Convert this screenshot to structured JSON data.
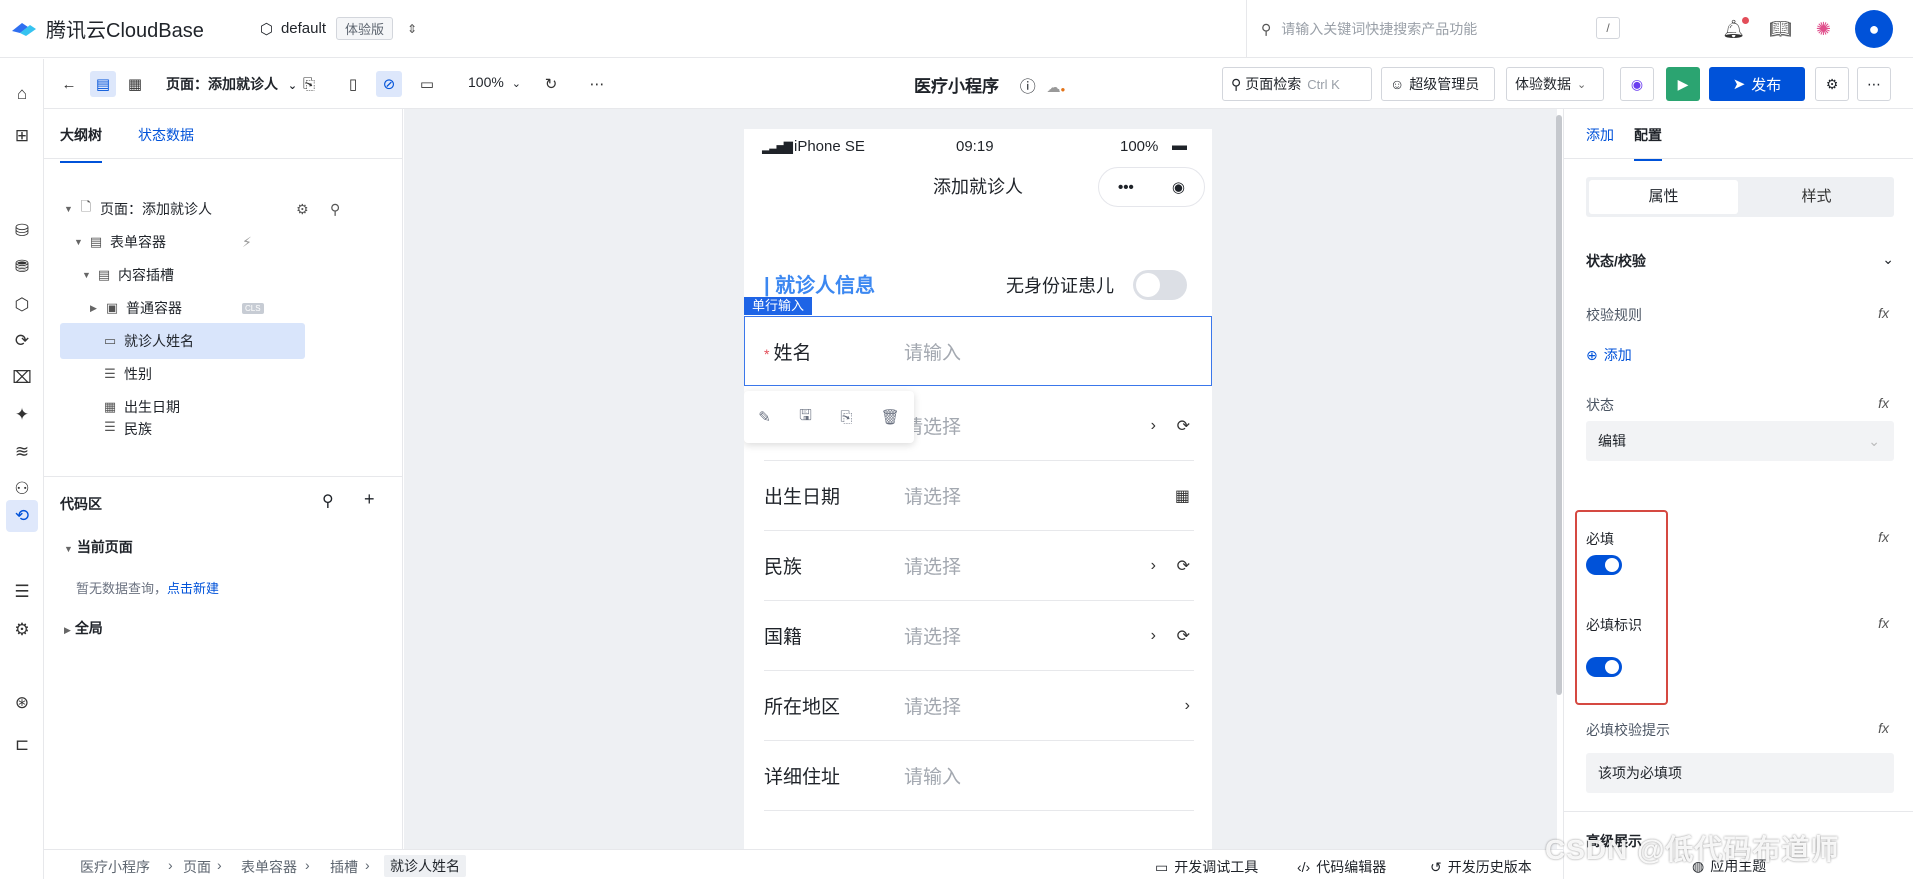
{
  "topbar": {
    "brand": "腾讯云CloudBase",
    "env_name": "default",
    "env_badge": "体验版",
    "search_placeholder": "请输入关键词快捷搜索产品功能",
    "search_shortcut": "/"
  },
  "toolbar": {
    "page_label": "页面：添加就诊人",
    "zoom": "100%",
    "app_title": "医疗小程序",
    "page_search": "页面检索",
    "page_search_shortcut": "Ctrl K",
    "role": "超级管理员",
    "data_mode": "体验数据",
    "publish": "发布"
  },
  "left_panel": {
    "tab_outline": "大纲树",
    "tab_state": "状态数据",
    "tree": [
      {
        "label": "页面：添加就诊人"
      },
      {
        "label": "表单容器"
      },
      {
        "label": "内容插槽"
      },
      {
        "label": "普通容器",
        "tag": "CLS"
      },
      {
        "label": "就诊人姓名"
      },
      {
        "label": "性别"
      },
      {
        "label": "出生日期"
      },
      {
        "label": "民族"
      }
    ],
    "code_title": "代码区",
    "current_page": "当前页面",
    "no_query": "暂无数据查询，",
    "new_link": "点击新建",
    "global": "全局"
  },
  "phone": {
    "carrier": "iPhone SE",
    "time": "09:19",
    "battery": "100%",
    "nav_title": "添加就诊人",
    "section_title": "| 就诊人信息",
    "no_id_child": "无身份证患儿",
    "single_input_tag": "单行输入",
    "fields": [
      {
        "label": "姓名",
        "placeholder": "请输入",
        "required": "*"
      },
      {
        "label": "",
        "placeholder": "请选择"
      },
      {
        "label": "出生日期",
        "placeholder": "请选择"
      },
      {
        "label": "民族",
        "placeholder": "请选择"
      },
      {
        "label": "国籍",
        "placeholder": "请选择"
      },
      {
        "label": "所在地区",
        "placeholder": "请选择"
      },
      {
        "label": "详细住址",
        "placeholder": "请输入"
      }
    ]
  },
  "right_panel": {
    "tab_add": "添加",
    "tab_config": "配置",
    "seg_props": "属性",
    "seg_style": "样式",
    "section_state": "状态/校验",
    "rules_label": "校验规则",
    "add_rule": "添加",
    "state_label": "状态",
    "state_value": "编辑",
    "required_label": "必填",
    "required_mark_label": "必填标识",
    "required_hint_label": "必填校验提示",
    "required_hint_value": "该项为必填项",
    "more_section": "高级展示"
  },
  "footer": {
    "crumbs": [
      "医疗小程序",
      "页面",
      "表单容器",
      "插槽",
      "就诊人姓名"
    ],
    "dev_tools": "开发调试工具",
    "code_editor": "代码编辑器",
    "history": "开发历史版本",
    "theme": "应用主题"
  },
  "watermark": "CSDN @低代码布道师",
  "colors": {
    "primary": "#0052d9",
    "success": "#2ba471",
    "section_title": "#3c88f1",
    "highlight_box": "#d54941"
  }
}
